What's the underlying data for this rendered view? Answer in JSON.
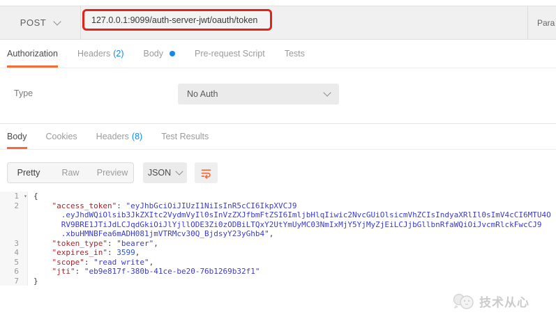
{
  "request_bar": {
    "method": "POST",
    "url": "127.0.0.1:9099/auth-server-jwt/oauth/token",
    "params_label": "Para"
  },
  "request_tabs": [
    {
      "label": "Authorization",
      "active": true
    },
    {
      "label": "Headers",
      "count": "(2)"
    },
    {
      "label": "Body",
      "dot": true
    },
    {
      "label": "Pre-request Script"
    },
    {
      "label": "Tests"
    }
  ],
  "auth_section": {
    "type_label": "Type",
    "auth_type": "No Auth"
  },
  "response_tabs": [
    {
      "label": "Body",
      "active": true
    },
    {
      "label": "Cookies"
    },
    {
      "label": "Headers",
      "count": "(8)"
    },
    {
      "label": "Test Results"
    }
  ],
  "response_toolbar": {
    "view_modes": [
      {
        "label": "Pretty",
        "active": true
      },
      {
        "label": "Raw"
      },
      {
        "label": "Preview"
      }
    ],
    "format": "JSON",
    "wrap_icon": "wrap-text-icon"
  },
  "response_body": {
    "language": "json",
    "fields": {
      "token_type": "bearer",
      "expires_in": 3599,
      "scope": "read write",
      "jti": "eb9e817f-380b-41ce-be20-76b1269b32f1"
    },
    "lines": [
      {
        "num": "1",
        "fold": true,
        "segments": [
          {
            "t": "{",
            "c": "plain"
          }
        ]
      },
      {
        "num": "2",
        "segments": [
          {
            "t": "    ",
            "c": "plain"
          },
          {
            "t": "\"access_token\"",
            "c": "key"
          },
          {
            "t": ": ",
            "c": "plain"
          },
          {
            "t": "\"eyJhbGciOiJIUzI1NiIsInR5cCI6IkpXVCJ9",
            "c": "str"
          }
        ]
      },
      {
        "num": "",
        "segments": [
          {
            "t": "      ",
            "c": "plain"
          },
          {
            "t": ".eyJhdWQiOlsib3JkZXItc2VydmVyIl0sInVzZXJfbmFtZSI6ImljbHlqIiwic2NvcGUiOlsicmVhZCIsIndyaXRlIl0sImV4cCI6MTU4O",
            "c": "str"
          }
        ]
      },
      {
        "num": "",
        "segments": [
          {
            "t": "      ",
            "c": "plain"
          },
          {
            "t": "RV9BRE1JTiJdLCJqdGkiOiJlYjllODE3Zi0zODBiLTQxY2UtYmUyMC03NmIxMjY5YjMyZjEiLCJjbGllbnRfaWQiOiJvcmRlckFwcCJ9",
            "c": "str"
          }
        ]
      },
      {
        "num": "",
        "segments": [
          {
            "t": "      ",
            "c": "plain"
          },
          {
            "t": ".xbuHMNBFea6mADH081jmVTRMcv30Q_BjdsyY23yGhb4\"",
            "c": "str"
          },
          {
            "t": ",",
            "c": "plain"
          }
        ]
      },
      {
        "num": "3",
        "segments": [
          {
            "t": "    ",
            "c": "plain"
          },
          {
            "t": "\"token_type\"",
            "c": "key"
          },
          {
            "t": ": ",
            "c": "plain"
          },
          {
            "t": "\"bearer\"",
            "c": "str"
          },
          {
            "t": ",",
            "c": "plain"
          }
        ]
      },
      {
        "num": "4",
        "segments": [
          {
            "t": "    ",
            "c": "plain"
          },
          {
            "t": "\"expires_in\"",
            "c": "key"
          },
          {
            "t": ": ",
            "c": "plain"
          },
          {
            "t": "3599",
            "c": "num"
          },
          {
            "t": ",",
            "c": "plain"
          }
        ]
      },
      {
        "num": "5",
        "segments": [
          {
            "t": "    ",
            "c": "plain"
          },
          {
            "t": "\"scope\"",
            "c": "key"
          },
          {
            "t": ": ",
            "c": "plain"
          },
          {
            "t": "\"read write\"",
            "c": "str"
          },
          {
            "t": ",",
            "c": "plain"
          }
        ]
      },
      {
        "num": "6",
        "segments": [
          {
            "t": "    ",
            "c": "plain"
          },
          {
            "t": "\"jti\"",
            "c": "key"
          },
          {
            "t": ": ",
            "c": "plain"
          },
          {
            "t": "\"eb9e817f-380b-41ce-be20-76b1269b32f1\"",
            "c": "str"
          }
        ]
      },
      {
        "num": "7",
        "segments": [
          {
            "t": "}",
            "c": "plain"
          }
        ]
      }
    ]
  },
  "watermark": {
    "text": "技术从心"
  },
  "colors": {
    "accent_orange": "#f26b3a",
    "badge_blue": "#1287ed",
    "url_highlight_red": "#e0241a",
    "key_color": "#a5262b",
    "string_color": "#3b3bd1",
    "number_color": "#2c55d4"
  }
}
